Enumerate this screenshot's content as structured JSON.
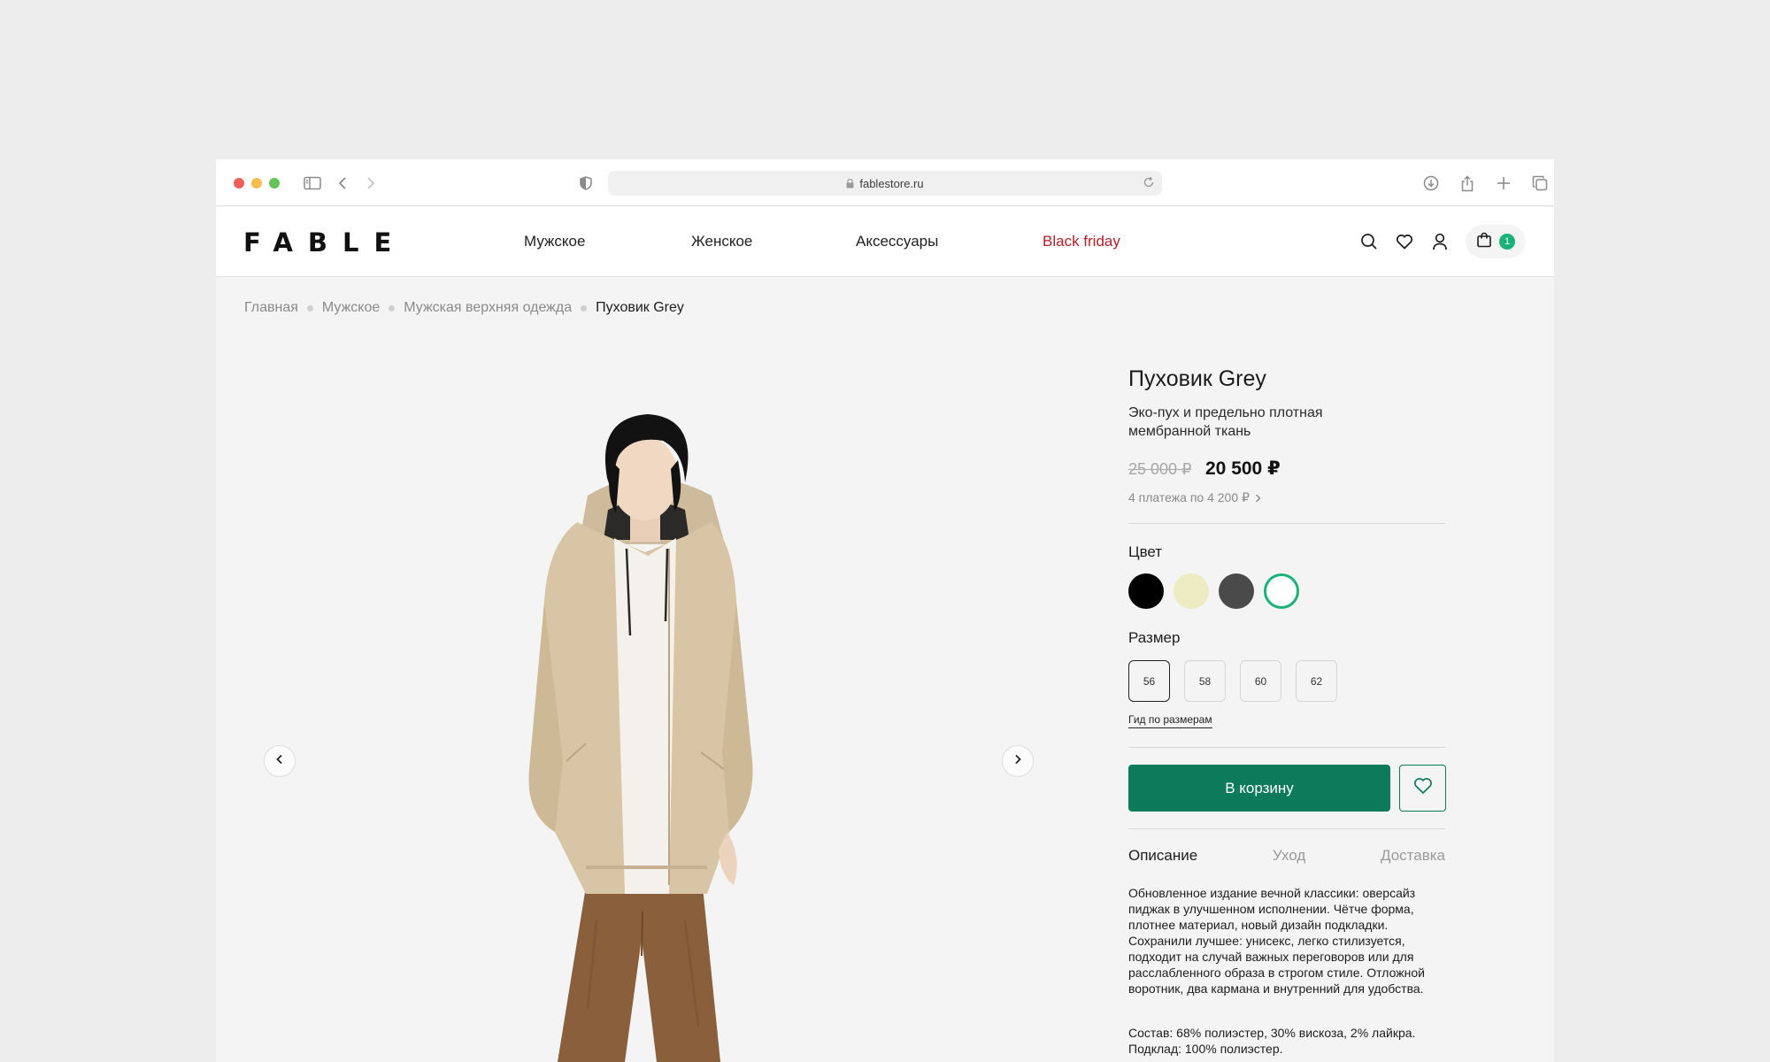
{
  "browser": {
    "url": "fablestore.ru",
    "traffic_lights": [
      "#ed5f57",
      "#f5bd4f",
      "#61c454"
    ]
  },
  "header": {
    "logo": "FABLE",
    "nav": [
      "Мужское",
      "Женское",
      "Аксессуары",
      "Black friday"
    ],
    "accent_color": "#b0202a",
    "cart_count": "1"
  },
  "breadcrumb": [
    "Главная",
    "Мужское",
    "Мужская верхняя одежда",
    "Пуховик Grey"
  ],
  "product": {
    "title": "Пуховик Grey",
    "subtitle": "Эко-пух и предельно плотная мембранной ткань",
    "old_price": "25 000 ₽",
    "price": "20 500 ₽",
    "installments": "4 платежа по 4 200 ₽",
    "color_label": "Цвет",
    "colors": [
      "#000000",
      "#ecebc1",
      "#4a4a4a",
      "#ffffff"
    ],
    "selected_color_index": 3,
    "size_label": "Размер",
    "sizes": [
      "56",
      "58",
      "60",
      "62"
    ],
    "selected_size": "56",
    "size_guide": "Гид по размерам",
    "add_to_cart": "В корзину",
    "brand_color": "#0d7a5a",
    "tabs": [
      "Описание",
      "Уход",
      "Доставка"
    ],
    "description": "Обновленное издание вечной классики: оверсайз пиджак в улучшенном исполнении. Чётче форма, плотнее материал, новый дизайн подкладки. Сохранили лучшее: унисекс, легко стилизуется, подходит на случай важных переговоров или для расслабленного образа в строгом стиле. Отложной воротник, два кармана и внутренний для удобства.",
    "composition": "Состав: 68% полиэстер, 30% вискоза, 2% лайкра. Подклад: 100% полиэстер."
  }
}
